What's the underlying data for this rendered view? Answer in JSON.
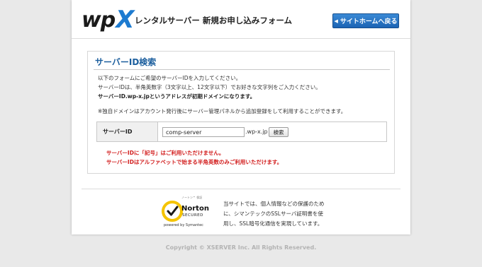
{
  "header": {
    "logo_wp": "wp",
    "logo_x": "X",
    "title": "レンタルサーバー 新規お申し込みフォーム",
    "back_button": "サイトホームへ戻る",
    "back_icon": "chevron-left-icon"
  },
  "section": {
    "title": "サーバーID検索",
    "desc": [
      "以下のフォームにご希望のサーバーIDを入力してください。",
      "サーバーIDは、半角英数字（3文字以上、12文字以下）でお好きな文字列をご入力ください。",
      "サーバーID.wp-x.jpというアドレスが初期ドメインになります。",
      "※独自ドメインはアカウント発行後にサーバー管理パネルから追加登録をして利用することができます。"
    ],
    "form": {
      "label": "サーバーID",
      "value": "comp-server",
      "domain_suffix": ".wp-x.jp",
      "search_button": "検索"
    },
    "errors": [
      "サーバーIDに「記号」はご利用いただけません。",
      "サーバーIDはアルファベットで始まる半角英数のみご利用いただけます。"
    ]
  },
  "norton": {
    "small_text": "ノートン™ 保証",
    "name": "Norton",
    "secured": "SECURED",
    "powered": "powered by Symantec",
    "seal_color": "#f5c400"
  },
  "ssl": [
    "当サイトでは、個人情報などの保護のため",
    "に、シマンテックのSSLサーバ証明書を使",
    "用し、SSL暗号化通信を実現しています。"
  ],
  "copyright": "Copyright © XSERVER Inc. All Rights Reserved.",
  "colors": {
    "accent": "#1d7bd0",
    "section_title": "#1c5f9e",
    "error": "#d21e1e",
    "button": "#2a76c6"
  }
}
